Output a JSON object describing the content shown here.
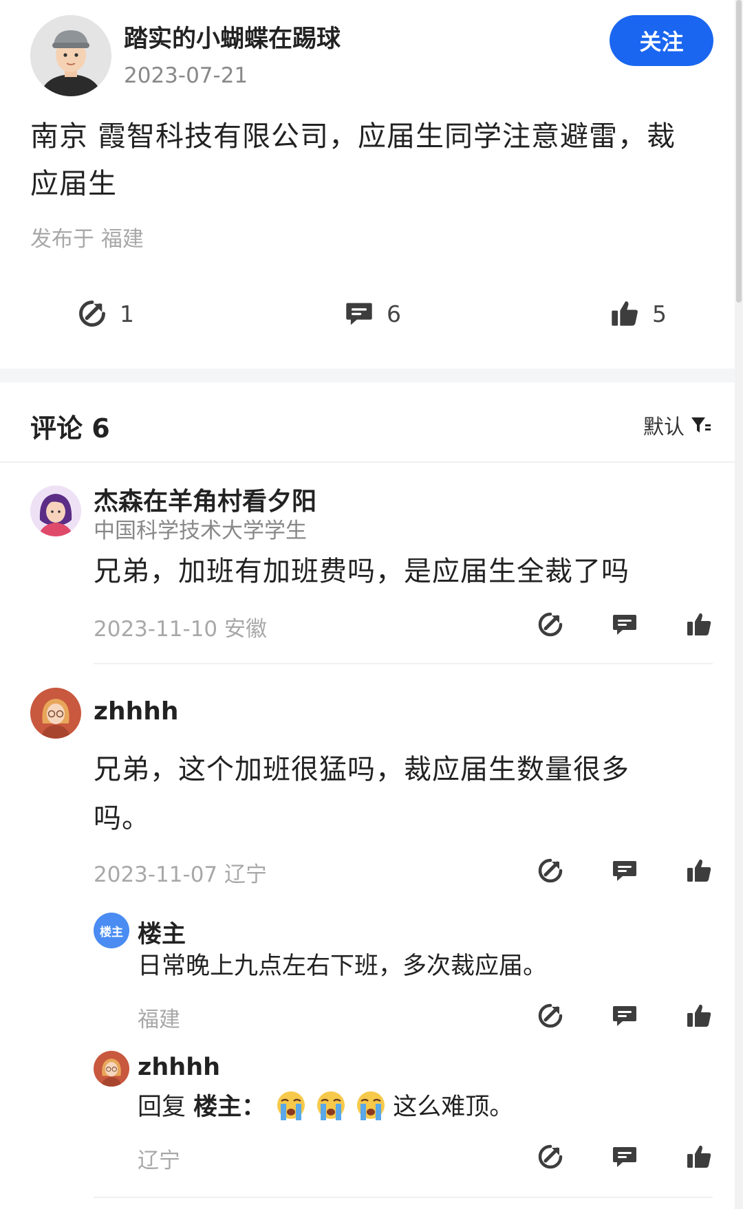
{
  "post": {
    "author": "踏实的小蝴蝶在踢球",
    "date": "2023-07-21",
    "follow_label": "关注",
    "content": "南京 霞智科技有限公司，应届生同学注意避雷，裁应届生",
    "location": "发布于 福建",
    "stats": {
      "shares": "1",
      "comments": "6",
      "likes": "5"
    }
  },
  "comments_header": {
    "title": "评论 6",
    "sort_label": "默认"
  },
  "comments": [
    {
      "name": "杰森在羊角村看夕阳",
      "subtitle": "中国科学技术大学学生",
      "text": "兄弟，加班有加班费吗，是应届生全裁了吗",
      "meta": "2023-11-10 安徽"
    },
    {
      "name": "zhhhh",
      "text": "兄弟，这个加班很猛吗，裁应届生数量很多吗。",
      "meta": "2023-11-07 辽宁",
      "replies": [
        {
          "badge": "楼主",
          "name": "楼主",
          "text": "日常晚上九点左右下班，多次裁应届。",
          "meta": "福建"
        },
        {
          "name": "zhhhh",
          "reply_prefix": "回复 ",
          "reply_to": "楼主：",
          "text": "这么难顶。",
          "emoji": "crying-face",
          "emoji_count": 3,
          "meta": "辽宁"
        }
      ]
    }
  ],
  "colors": {
    "accent": "#1a66f0",
    "badge": "#4a8cf2",
    "meta_text": "#a8a8a8"
  }
}
